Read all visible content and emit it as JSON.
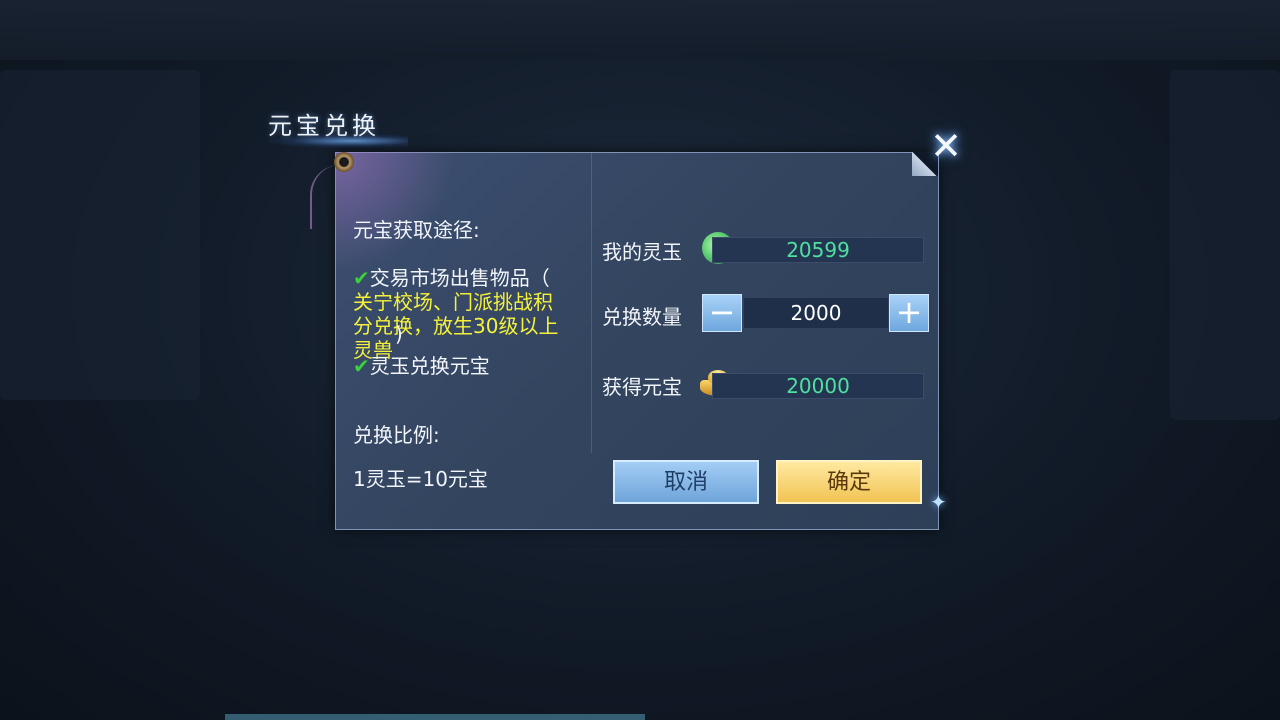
{
  "dialog": {
    "title": "元宝兑换",
    "left": {
      "ways_heading": "元宝获取途径:",
      "item1_check": "✔",
      "item1_text": "交易市场出售物品（",
      "item1_detail_line1": "关宁校场、门派挑战积",
      "item1_detail_line2": "分兑换，放生30级以上",
      "item1_detail_line3": "灵兽",
      "item1_close": ")",
      "item2_check": "✔",
      "item2_text": "灵玉兑换元宝",
      "ratio_heading": "兑换比例:",
      "ratio_value": "1灵玉=10元宝"
    },
    "right": {
      "my_jade_label": "我的灵玉",
      "my_jade_value": "20599",
      "exchange_qty_label": "兑换数量",
      "exchange_qty_value": "2000",
      "minus_label": "−",
      "plus_label": "+",
      "obtain_label": "获得元宝",
      "obtain_value": "20000"
    },
    "buttons": {
      "cancel": "取消",
      "confirm": "确定"
    },
    "close_glyph": "✕",
    "sparkle_glyph": "✦"
  },
  "icons": {
    "jade": "jade-icon",
    "ingot": "gold-ingot-icon",
    "close": "close-icon"
  },
  "colors": {
    "highlight_text": "#f6f23a",
    "check": "#3bd13b",
    "value_text": "#4fe0a0",
    "confirm_button": "#f1c353",
    "cancel_button": "#6fa5da"
  }
}
